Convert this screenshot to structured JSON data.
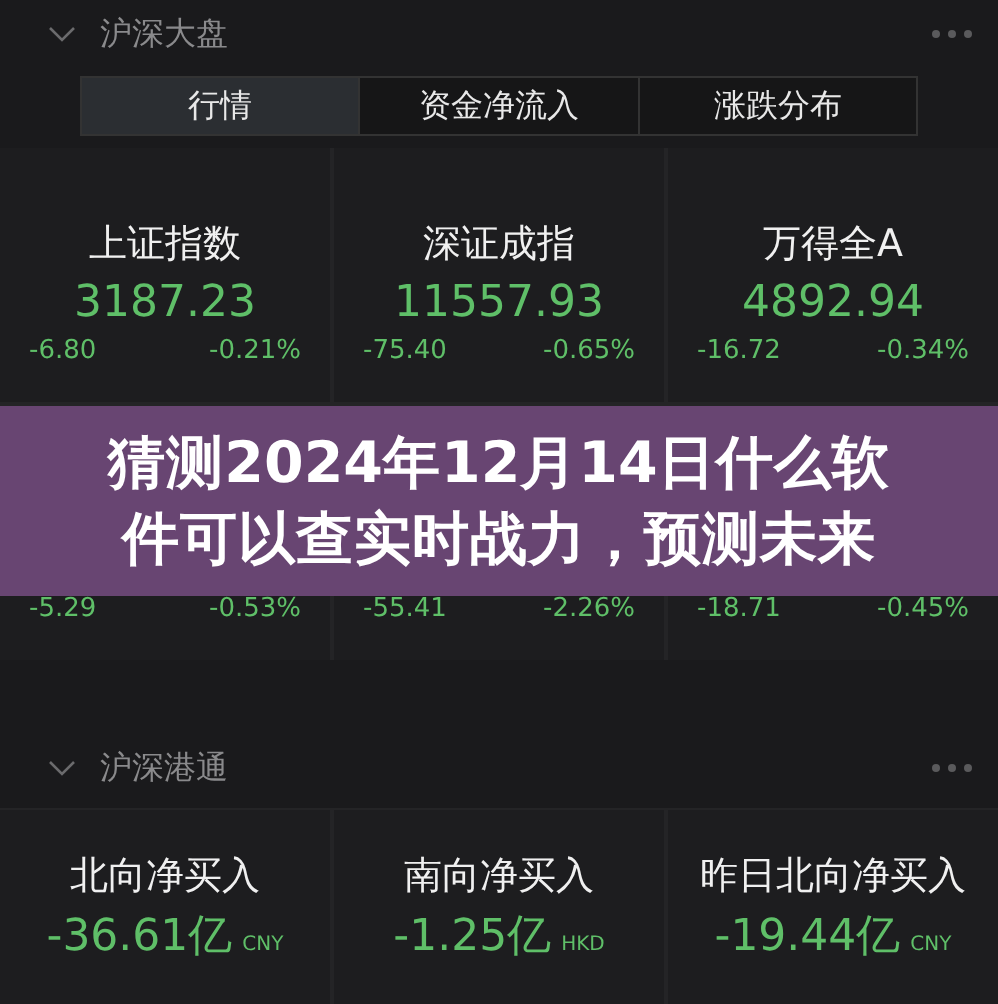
{
  "sections": [
    {
      "title": "沪深大盘",
      "expanded": true,
      "tabs": [
        {
          "label": "行情",
          "selected": true
        },
        {
          "label": "资金净流入",
          "selected": false
        },
        {
          "label": "涨跌分布",
          "selected": false
        }
      ],
      "cards": [
        {
          "name": "上证指数",
          "value": "3187.23",
          "change": "-6.80",
          "percent": "-0.21%"
        },
        {
          "name": "深证成指",
          "value": "11557.93",
          "change": "-75.40",
          "percent": "-0.65%"
        },
        {
          "name": "万得全A",
          "value": "4892.94",
          "change": "-16.72",
          "percent": "-0.34%"
        },
        {
          "change": "-5.29",
          "percent": "-0.53%"
        },
        {
          "change": "-55.41",
          "percent": "-2.26%"
        },
        {
          "change": "-18.71",
          "percent": "-0.45%"
        }
      ]
    },
    {
      "title": "沪深港通",
      "expanded": true,
      "cards": [
        {
          "name": "北向净买入",
          "value": "-36.61亿",
          "unit": "CNY"
        },
        {
          "name": "南向净买入",
          "value": "-1.25亿",
          "unit": "HKD"
        },
        {
          "name": "昨日北向净买入",
          "value": "-19.44亿",
          "unit": "CNY"
        }
      ]
    }
  ],
  "banner": {
    "title": "猜测2024年12月14日什么软件可以查实时战力，预测未来"
  }
}
